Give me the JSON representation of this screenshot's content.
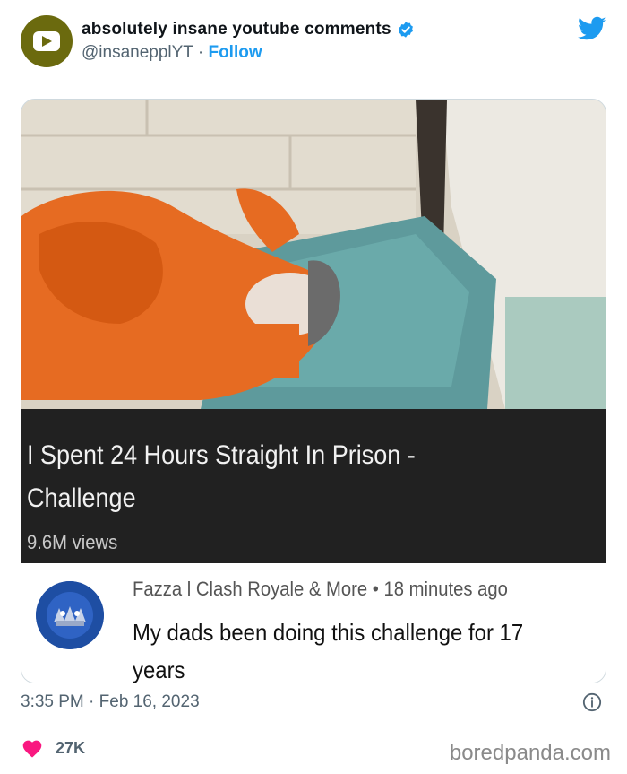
{
  "header": {
    "display_name": "absolutely insane youtube comments",
    "handle": "@insanepplYT",
    "separator": "·",
    "follow_label": "Follow"
  },
  "media": {
    "video_title": "I Spent 24 Hours Straight In Prison - Challenge",
    "views": "9.6M views"
  },
  "comment": {
    "author": "Fazza l Clash Royale & More",
    "bullet": "•",
    "time_ago": "18 minutes ago",
    "text": "My dads been doing this challenge for 17 years"
  },
  "footer": {
    "time": "3:35 PM",
    "separator": "·",
    "date": "Feb 16, 2023",
    "likes": "27K",
    "watermark": "boredpanda.com"
  },
  "colors": {
    "accent": "#1d9bf0",
    "like_heart": "#f91880",
    "avatar_bg": "#6b6a0e",
    "video_bar": "#212121"
  },
  "icons": [
    "youtube-logo-icon",
    "verified-badge-icon",
    "twitter-bird-icon",
    "info-icon",
    "heart-icon"
  ]
}
